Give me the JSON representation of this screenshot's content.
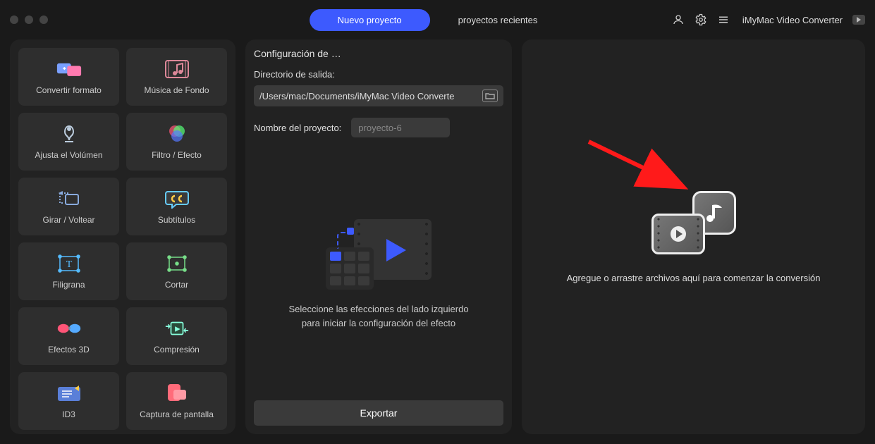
{
  "header": {
    "tab_new": "Nuevo proyecto",
    "tab_recent": "proyectos recientes",
    "app_name": "iMyMac Video Converter"
  },
  "sidebar": {
    "tools": [
      {
        "label": "Convertir formato"
      },
      {
        "label": "Música de Fondo"
      },
      {
        "label": "Ajusta el Volúmen"
      },
      {
        "label": "Filtro / Efecto"
      },
      {
        "label": "Girar / Voltear"
      },
      {
        "label": "Subtítulos"
      },
      {
        "label": "Filigrana"
      },
      {
        "label": "Cortar"
      },
      {
        "label": "Efectos 3D"
      },
      {
        "label": "Compresión"
      },
      {
        "label": "ID3"
      },
      {
        "label": "Captura de pantalla"
      }
    ]
  },
  "center": {
    "title": "Configuración de …",
    "output_dir_label": "Directorio de salida:",
    "output_dir_value": "/Users/mac/Documents/iMyMac Video Converte",
    "project_name_label": "Nombre del proyecto:",
    "project_name_value": "proyecto-6",
    "hint_line1": "Seleccione las efecciones del lado izquierdo",
    "hint_line2": "para iniciar la configuración del efecto",
    "export_label": "Exportar"
  },
  "drop": {
    "text": "Agregue o arrastre archivos aquí para comenzar la conversión"
  }
}
